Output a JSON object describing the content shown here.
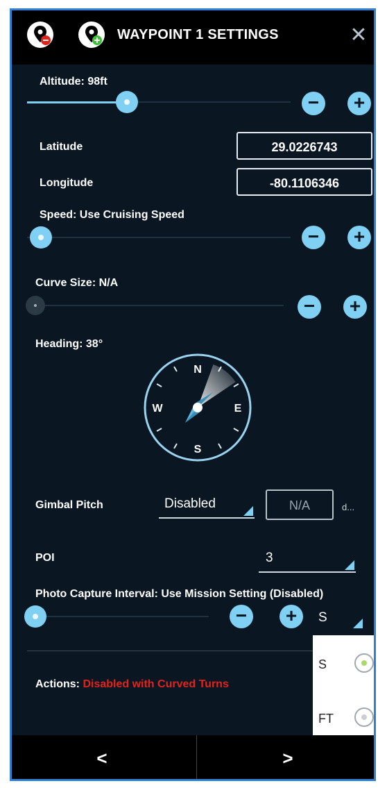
{
  "header": {
    "title": "WAYPOINT 1 SETTINGS",
    "remove_icon": "pin-remove-icon",
    "add_icon": "pin-add-icon",
    "close_label": "✕"
  },
  "altitude": {
    "label": "Altitude: 98ft",
    "level": 0.38
  },
  "latitude": {
    "label": "Latitude",
    "value": "29.0226743"
  },
  "longitude": {
    "label": "Longitude",
    "value": "-80.1106346"
  },
  "speed": {
    "label": "Speed: Use Cruising Speed",
    "level": 0.0
  },
  "curve": {
    "label": "Curve Size: N/A",
    "level": 0.0
  },
  "heading": {
    "label": "Heading: 38°",
    "degrees": 38,
    "compass": {
      "n": "N",
      "e": "E",
      "s": "S",
      "w": "W"
    }
  },
  "gimbal": {
    "label": "Gimbal Pitch",
    "mode": "Disabled",
    "value": "N/A",
    "unit": "d..."
  },
  "poi": {
    "label": "POI",
    "value": "3"
  },
  "photo": {
    "label": "Photo Capture Interval: Use Mission Setting (Disabled)",
    "unit": "S",
    "level": 0.0
  },
  "unit_popup": {
    "options": [
      {
        "label": "S",
        "selected": true
      },
      {
        "label": "FT",
        "selected": false
      }
    ]
  },
  "actions": {
    "label": "Actions:",
    "value": "Disabled with Curved Turns"
  },
  "footer": {
    "prev": "<",
    "next": ">"
  },
  "controls": {
    "minus": "−",
    "plus": "+"
  },
  "colors": {
    "accent": "#7fd0f2",
    "warning": "#e0241b",
    "background": "#0a1723"
  }
}
